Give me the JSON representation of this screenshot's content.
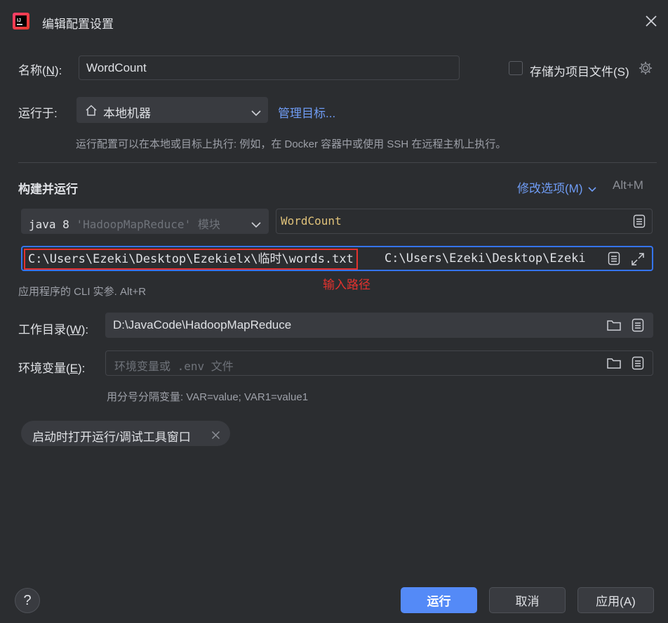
{
  "window": {
    "title": "编辑配置设置",
    "close_icon": "close-icon",
    "app_icon": "intellij-idea-icon"
  },
  "name": {
    "label_prefix": "名称(",
    "label_mnemonic": "N",
    "label_suffix": "):",
    "value": "WordCount"
  },
  "store_as_project_file": {
    "label": "存储为项目文件(S)",
    "checked": false
  },
  "run_on": {
    "label": "运行于:",
    "value": "本地机器",
    "manage_link": "管理目标...",
    "hint": "运行配置可以在本地或目标上执行: 例如，在 Docker 容器中或使用 SSH 在远程主机上执行。"
  },
  "build_run": {
    "title": "构建并运行",
    "modify_options": "修改选项(M)",
    "shortcut": "Alt+M",
    "jdk": {
      "prefix": "java 8",
      "module": "'HadoopMapReduce'",
      "suffix": "模块"
    },
    "main_class": "WordCount",
    "program_args": {
      "highlighted": "C:\\Users\\Ezeki\\Desktop\\Ezekielx\\临时\\words.txt",
      "rest": "C:\\Users\\Ezeki\\Desktop\\Ezeki"
    },
    "annotation": "输入路径",
    "args_hint": "应用程序的 CLI 实参. Alt+R"
  },
  "working_dir": {
    "label_prefix": "工作目录(",
    "label_mnemonic": "W",
    "label_suffix": "):",
    "value": "D:\\JavaCode\\HadoopMapReduce"
  },
  "env": {
    "label_prefix": "环境变量(",
    "label_mnemonic": "E",
    "label_suffix": "):",
    "placeholder": "环境变量或 .env 文件",
    "hint": "用分号分隔变量: VAR=value; VAR1=value1"
  },
  "chip": {
    "label": "启动时打开运行/调试工具窗口"
  },
  "buttons": {
    "help": "?",
    "run": "运行",
    "cancel": "取消",
    "apply": "应用(A)"
  },
  "colors": {
    "accent": "#548af7",
    "annotation_red": "#e5322e",
    "background": "#2b2d30"
  }
}
